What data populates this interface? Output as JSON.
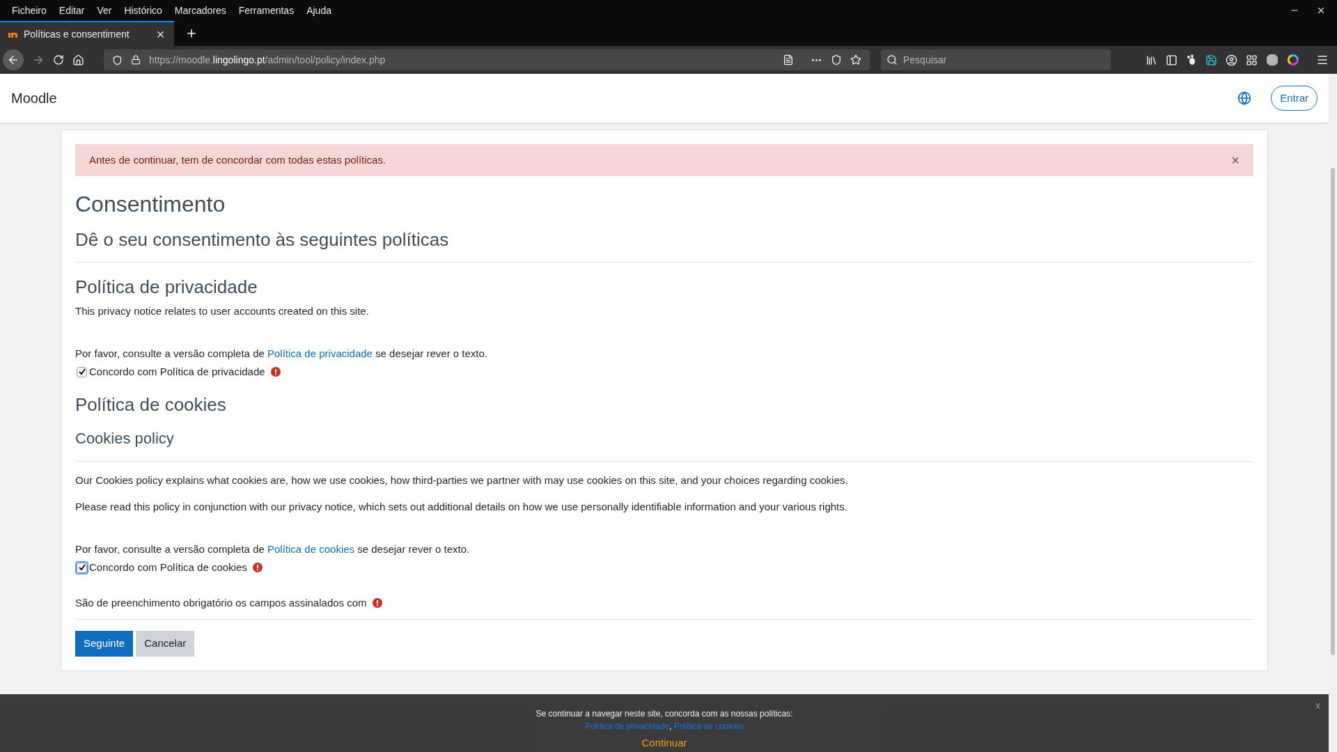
{
  "menu": [
    "Ficheiro",
    "Editar",
    "Ver",
    "Histórico",
    "Marcadores",
    "Ferramentas",
    "Ajuda"
  ],
  "tab": {
    "title": "Políticas e consentiment",
    "selected": true
  },
  "address": {
    "parts": [
      {
        "text": "https://moodle.",
        "strong": false
      },
      {
        "text": "lingolingo.pt",
        "strong": true
      },
      {
        "text": "/admin/tool/policy/index.php",
        "strong": false
      }
    ]
  },
  "search": {
    "placeholder": "Pesquisar"
  },
  "header": {
    "brand": "Moodle",
    "login": "Entrar"
  },
  "alert": {
    "text": "Antes de continuar, tem de concordar com todas estas políticas.",
    "close": "×"
  },
  "title": "Consentimento",
  "subtitle": "Dê o seu consentimento às seguintes políticas",
  "policies": [
    {
      "heading": "Política de privacidade",
      "paragraphs": [
        "This privacy notice relates to user accounts created on this site."
      ],
      "prefix": "Por favor, consulte a versão completa de",
      "link": "Política de privacidade",
      "suffix": "se desejar rever o texto.",
      "agree": "Concordo com Política de privacidade",
      "checked": true,
      "focused": false
    },
    {
      "heading": "Política de cookies",
      "subheading": "Cookies policy",
      "paragraphs": [
        "Our Cookies policy explains what cookies are, how we use cookies, how third-parties we partner with may use cookies on this site, and your choices regarding cookies.",
        "Please read this policy in conjunction with our privacy notice, which sets out additional details on how we use personally identifiable information and your various rights."
      ],
      "prefix": "Por favor, consulte a versão completa de",
      "link": "Política de cookies",
      "suffix": "se desejar rever o texto.",
      "agree": "Concordo com Política de cookies",
      "checked": true,
      "focused": true
    }
  ],
  "required_note": "São de preenchimento obrigatório os campos assinalados com",
  "buttons": [
    {
      "label": "Seguinte",
      "kind": "primary"
    },
    {
      "label": "Cancelar",
      "kind": "secondary"
    }
  ],
  "banner": {
    "text": "Se continuar a navegar neste site, concorda com as nossas políticas:",
    "links": [
      "Política de privacidade",
      "Política de cookies"
    ],
    "separator": ",",
    "action": "Continuar",
    "close": "x"
  }
}
